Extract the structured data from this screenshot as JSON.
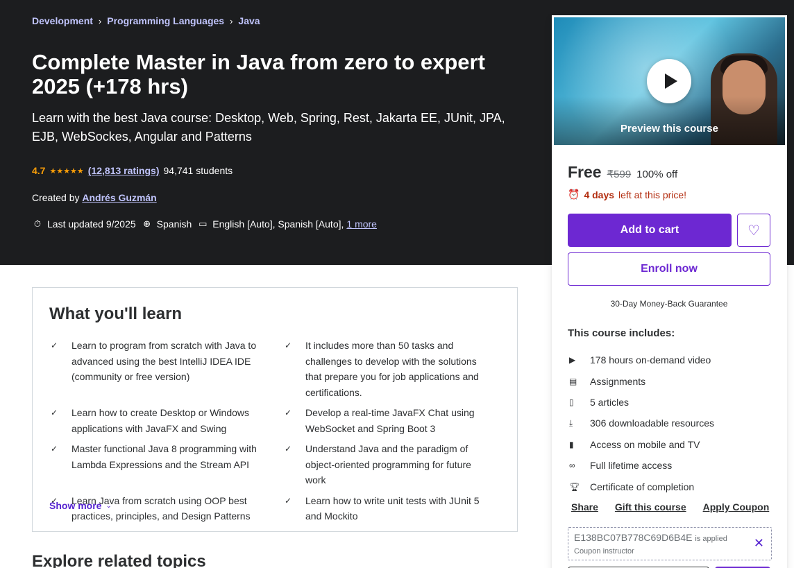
{
  "breadcrumb": [
    "Development",
    "Programming Languages",
    "Java"
  ],
  "course": {
    "title": "Complete Master in Java from zero to expert 2025 (+178 hrs)",
    "subtitle": "Learn with the best Java course: Desktop, Web, Spring, Rest, Jakarta EE, JUnit, JPA, EJB, WebSockes, Angular and Patterns",
    "rating": "4.7",
    "rating_value": 4.7,
    "ratings_count": "(12,813 ratings)",
    "students": "94,741 students",
    "created_by_label": "Created by",
    "instructor": "Andrés Guzmán",
    "last_updated": "Last updated 9/2025",
    "language": "Spanish",
    "captions": "English [Auto], Spanish [Auto],",
    "more_link": "1 more"
  },
  "learn": {
    "title": "What you'll learn",
    "items": [
      "Learn to program from scratch with Java to advanced using the best IntelliJ IDEA IDE (community or free version)",
      "It includes more than 50 tasks and challenges to develop with the solutions that prepare you for job applications and certifications.",
      "Learn how to create Desktop or Windows applications with JavaFX and Swing",
      "Develop a real-time JavaFX Chat using WebSocket and Spring Boot 3",
      "Master functional Java 8 programming with Lambda Expressions and the Stream API",
      "Understand Java and the paradigm of object-oriented programming for future work",
      "Learn Java from scratch using OOP best practices, principles, and Design Patterns",
      "Learn how to write unit tests with JUnit 5 and Mockito"
    ],
    "show_more": "Show more"
  },
  "related_title": "Explore related topics",
  "sidebar": {
    "preview_label": "Preview this course",
    "price": "Free",
    "old_price": "₹599",
    "discount": "100% off",
    "timer_bold": "4 days",
    "timer_rest": "left at this price!",
    "add_to_cart": "Add to cart",
    "enroll_now": "Enroll now",
    "guarantee": "30-Day Money-Back Guarantee",
    "includes_title": "This course includes:",
    "includes": [
      {
        "icon": "video-icon",
        "label": "178 hours on-demand video"
      },
      {
        "icon": "assignment-icon",
        "label": "Assignments"
      },
      {
        "icon": "article-icon",
        "label": "5 articles"
      },
      {
        "icon": "download-icon",
        "label": "306 downloadable resources"
      },
      {
        "icon": "mobile-icon",
        "label": "Access on mobile and TV"
      },
      {
        "icon": "infinity-icon",
        "label": "Full lifetime access"
      },
      {
        "icon": "trophy-icon",
        "label": "Certificate of completion"
      }
    ],
    "share": "Share",
    "gift": "Gift this course",
    "apply_coupon": "Apply Coupon",
    "coupon_code": "E138BC07B778C69D6B4E",
    "coupon_applied": "is applied",
    "coupon_source": "Coupon instructor"
  }
}
